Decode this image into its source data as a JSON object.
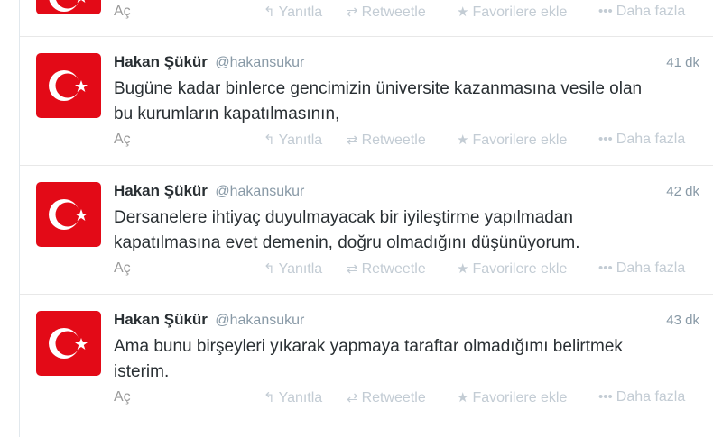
{
  "actions": {
    "expand": "Aç",
    "reply": "Yanıtla",
    "retweet": "Retweetle",
    "favorite": "Favorilere ekle",
    "more": "Daha fazla"
  },
  "icons": {
    "reply": "reply-icon",
    "retweet": "retweet-icon",
    "favorite": "star-icon",
    "more": "ellipsis-icon"
  },
  "colors": {
    "flag_red": "#e30a17",
    "action_gray": "#c3ccd4",
    "meta_gray": "#8899a6"
  },
  "tweets": [
    {
      "fullname": "Hakan Şükür",
      "username": "@hakansukur",
      "time": "41 dk",
      "text_line1": "Bugüne kadar binlerce gencimizin üniversite kazanmasına vesile olan",
      "text_line2": "bu kurumların kapatılmasının,"
    },
    {
      "fullname": "Hakan Şükür",
      "username": "@hakansukur",
      "time": "42 dk",
      "text_line1": "Dersanelere ihtiyaç duyulmayacak bir iyileştirme yapılmadan",
      "text_line2": "kapatılmasına evet demenin, doğru olmadığını düşünüyorum."
    },
    {
      "fullname": "Hakan Şükür",
      "username": "@hakansukur",
      "time": "43 dk",
      "text_line1": "Ama bunu birşeyleri yıkarak yapmaya taraftar olmadığımı belirtmek",
      "text_line2": "isterim."
    }
  ]
}
